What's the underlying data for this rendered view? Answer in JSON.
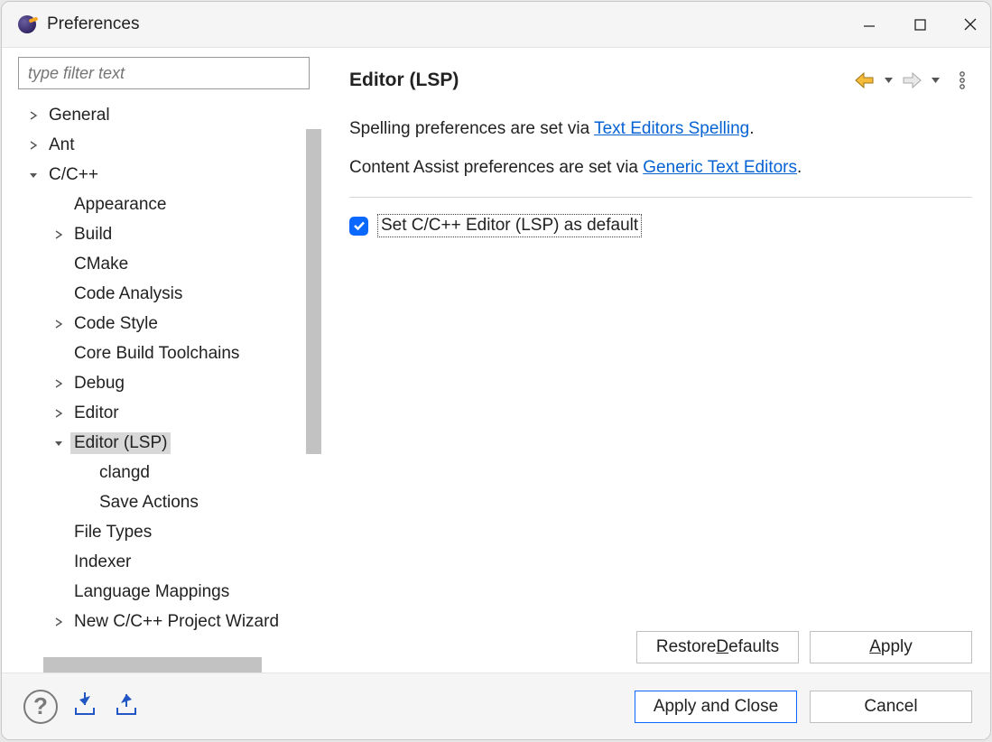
{
  "window": {
    "title": "Preferences"
  },
  "filter": {
    "placeholder": "type filter text"
  },
  "tree": {
    "items": [
      {
        "label": "General",
        "level": 0,
        "expandable": true,
        "expanded": false
      },
      {
        "label": "Ant",
        "level": 0,
        "expandable": true,
        "expanded": false
      },
      {
        "label": "C/C++",
        "level": 0,
        "expandable": true,
        "expanded": true
      },
      {
        "label": "Appearance",
        "level": 1,
        "expandable": false
      },
      {
        "label": "Build",
        "level": 1,
        "expandable": true,
        "expanded": false
      },
      {
        "label": "CMake",
        "level": 1,
        "expandable": false
      },
      {
        "label": "Code Analysis",
        "level": 1,
        "expandable": false
      },
      {
        "label": "Code Style",
        "level": 1,
        "expandable": true,
        "expanded": false
      },
      {
        "label": "Core Build Toolchains",
        "level": 1,
        "expandable": false
      },
      {
        "label": "Debug",
        "level": 1,
        "expandable": true,
        "expanded": false
      },
      {
        "label": "Editor",
        "level": 1,
        "expandable": true,
        "expanded": false
      },
      {
        "label": "Editor (LSP)",
        "level": 1,
        "expandable": true,
        "expanded": true,
        "selected": true
      },
      {
        "label": "clangd",
        "level": 2,
        "expandable": false
      },
      {
        "label": "Save Actions",
        "level": 2,
        "expandable": false
      },
      {
        "label": "File Types",
        "level": 1,
        "expandable": false
      },
      {
        "label": "Indexer",
        "level": 1,
        "expandable": false
      },
      {
        "label": "Language Mappings",
        "level": 1,
        "expandable": false
      },
      {
        "label": "New C/C++ Project Wizard",
        "level": 1,
        "expandable": true,
        "expanded": false
      }
    ]
  },
  "content": {
    "title": "Editor (LSP)",
    "spelling_prefix": "Spelling preferences are set via ",
    "spelling_link": "Text Editors Spelling",
    "assist_prefix": "Content Assist preferences are set via ",
    "assist_link": "Generic Text Editors",
    "checkbox_label": "Set C/C++ Editor (LSP) as default",
    "checkbox_checked": true
  },
  "buttons": {
    "restore_defaults": "Restore Defaults",
    "apply": "Apply",
    "apply_close": "Apply and Close",
    "cancel": "Cancel"
  }
}
